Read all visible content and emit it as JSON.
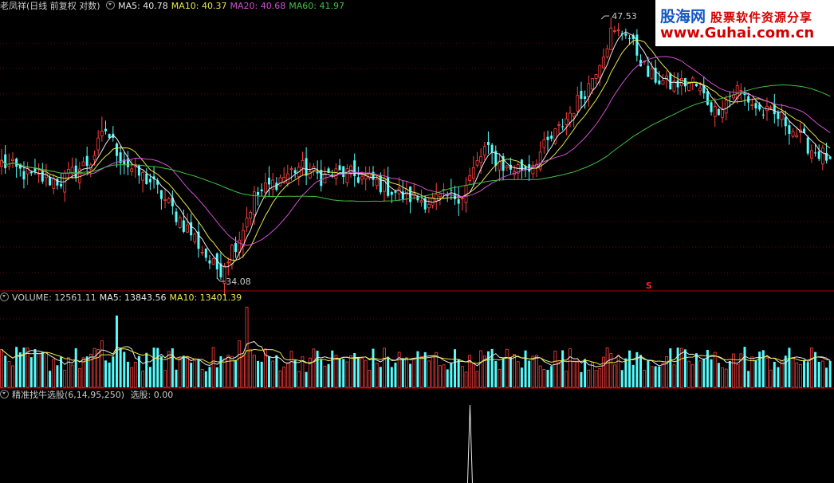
{
  "colors": {
    "up": "#ff4040",
    "down": "#54fcfc",
    "ma5": "#e8e8e8",
    "ma10": "#e6e64a",
    "ma20": "#d050d0",
    "ma60": "#40c040",
    "divider": "#b00000",
    "grid": "#6a0000",
    "signal": "#e8e8e8",
    "label": "#c8c8c8"
  },
  "icons": {
    "panel_toggle": "collapse-arrow-icon"
  },
  "title": {
    "stock": "老凤祥(日线 前复权 对数)"
  },
  "ma": [
    {
      "label": "MA5: 40.78",
      "color": "#e8e8e8"
    },
    {
      "label": "MA10: 40.37",
      "color": "#e6e64a"
    },
    {
      "label": "MA20: 40.68",
      "color": "#d050d0"
    },
    {
      "label": "MA60: 41.97",
      "color": "#40c040"
    }
  ],
  "price_markers": {
    "high": "47.53",
    "low": "34.08",
    "signal_mark": "S"
  },
  "volume": {
    "items": [
      {
        "label": "VOLUME: 12561.11",
        "color": "#c8c8c8"
      },
      {
        "label": "MA5: 13843.56",
        "color": "#e8e8e8"
      },
      {
        "label": "MA10: 13401.39",
        "color": "#e6e64a"
      }
    ]
  },
  "indicator": {
    "label": "精准找牛选股(6,14,95,250)",
    "value": "选股: 0.00"
  },
  "watermark": {
    "brand": "股海网",
    "slogan": "股票软件资源分享",
    "url": "www.Guhai.com.cn"
  },
  "chart_data": {
    "type": "candlestick",
    "price_range": [
      34.08,
      47.53
    ],
    "anchors": [
      [
        0,
        39.5
      ],
      [
        8,
        38.8
      ],
      [
        16,
        38.6
      ],
      [
        24,
        39.6
      ],
      [
        28,
        41.2
      ],
      [
        32,
        39.8
      ],
      [
        36,
        39.0
      ],
      [
        40,
        38.6
      ],
      [
        46,
        37.2
      ],
      [
        52,
        35.9
      ],
      [
        58,
        34.3
      ],
      [
        64,
        36.0
      ],
      [
        68,
        37.8
      ],
      [
        74,
        38.6
      ],
      [
        80,
        39.3
      ],
      [
        86,
        38.8
      ],
      [
        92,
        39.0
      ],
      [
        100,
        38.6
      ],
      [
        108,
        37.9
      ],
      [
        116,
        37.6
      ],
      [
        124,
        38.0
      ],
      [
        130,
        40.2
      ],
      [
        136,
        39.2
      ],
      [
        142,
        39.3
      ],
      [
        150,
        41.2
      ],
      [
        158,
        43.6
      ],
      [
        164,
        46.5
      ],
      [
        168,
        46.7
      ],
      [
        174,
        44.2
      ],
      [
        180,
        43.6
      ],
      [
        186,
        43.8
      ],
      [
        192,
        42.2
      ],
      [
        198,
        43.4
      ],
      [
        204,
        42.2
      ],
      [
        210,
        41.8
      ],
      [
        218,
        40.2
      ],
      [
        223,
        39.7
      ]
    ],
    "highlights": {
      "high": {
        "index": 164,
        "value": 47.53
      },
      "low": {
        "index": 58,
        "value": 34.08
      }
    },
    "signal_index": 131
  }
}
